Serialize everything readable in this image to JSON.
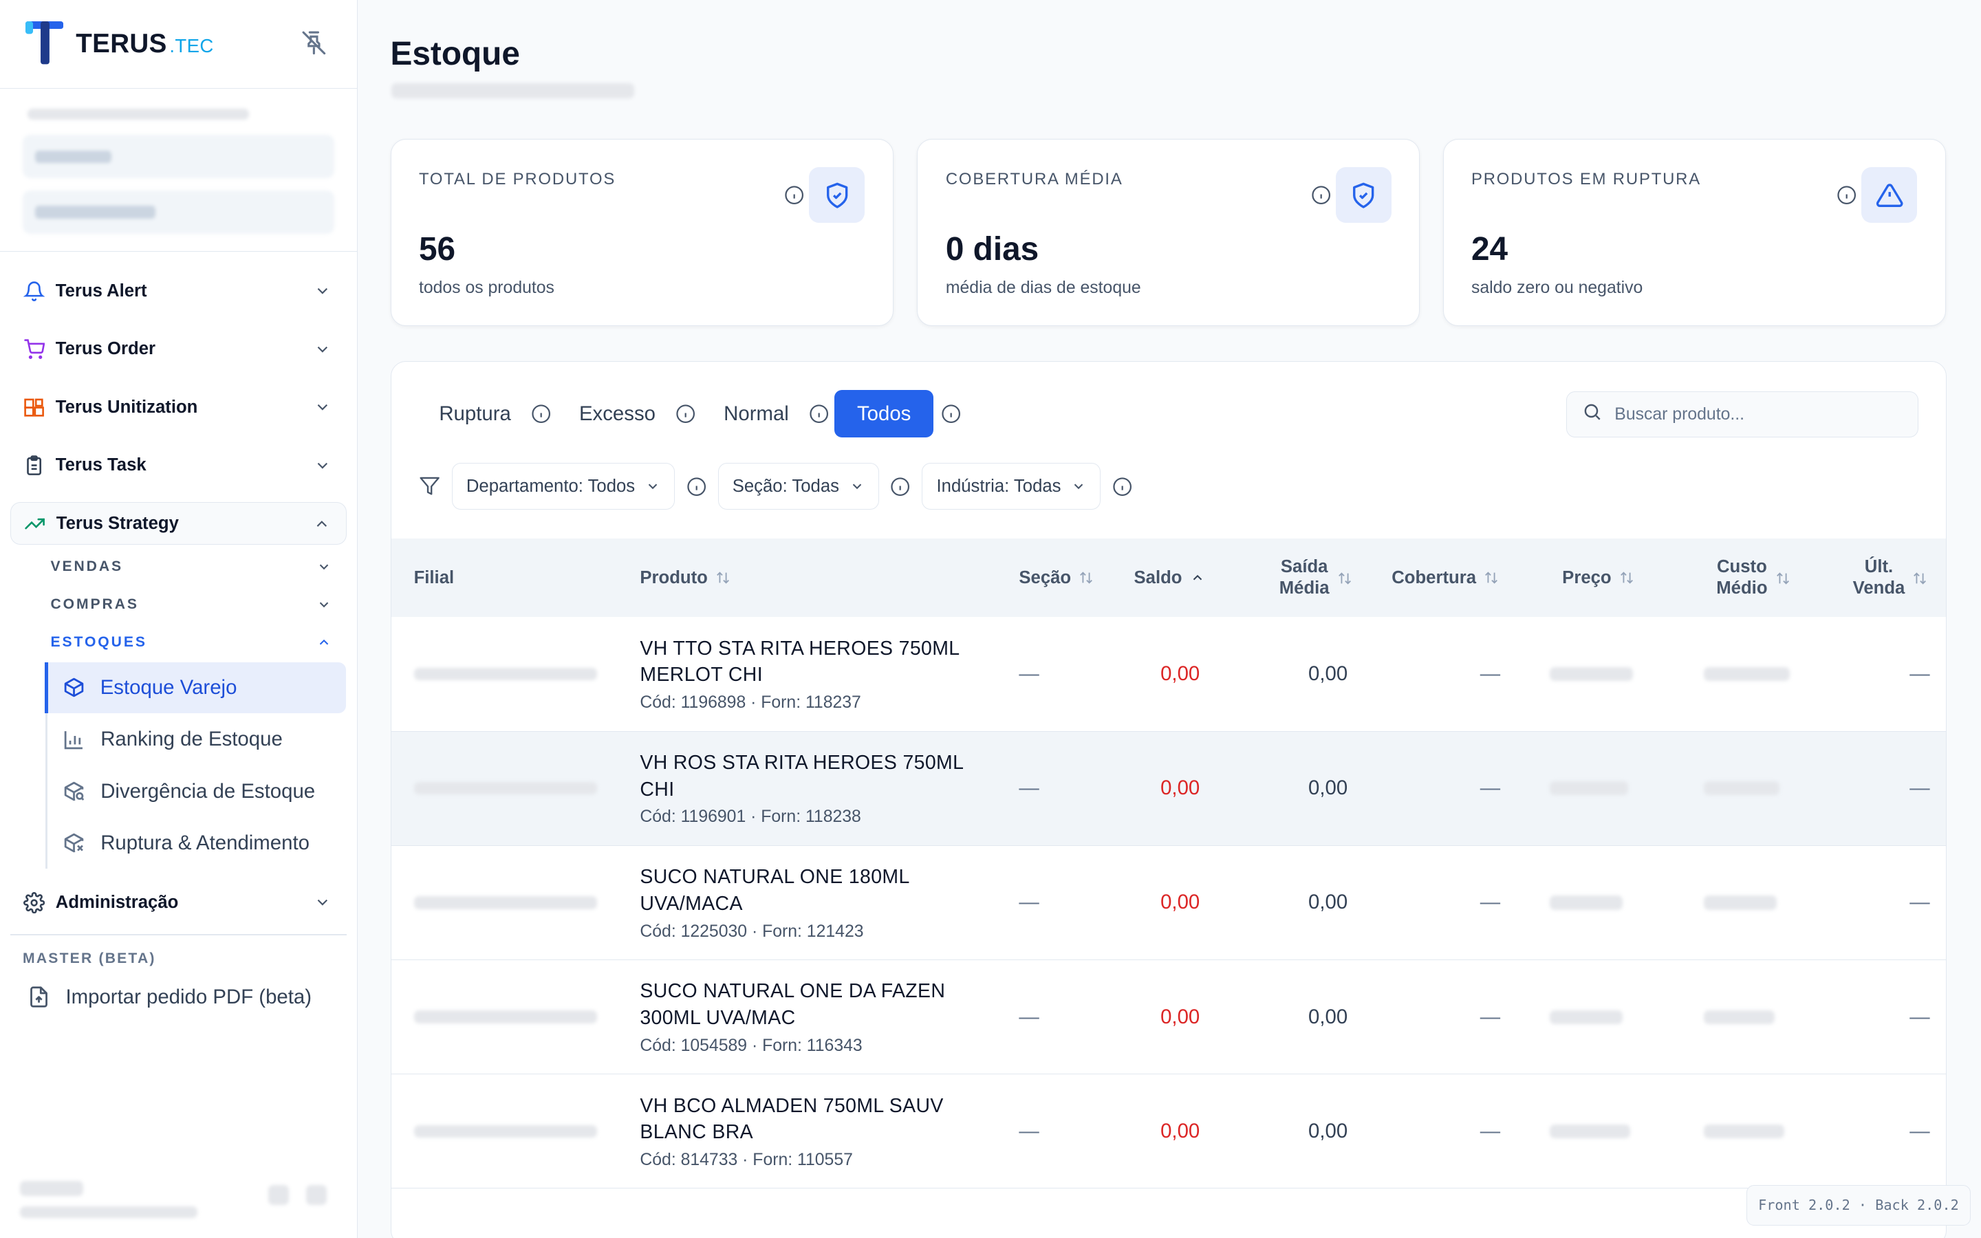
{
  "brand": {
    "name": "TERUS",
    "suffix": ".TEC",
    "primary": "#2563eb",
    "suffix_color": "#0ea5e9"
  },
  "sidebar": {
    "nav": [
      {
        "label": "Terus Alert",
        "icon": "bell-icon"
      },
      {
        "label": "Terus Order",
        "icon": "cart-icon"
      },
      {
        "label": "Terus Unitization",
        "icon": "boxes-icon"
      },
      {
        "label": "Terus Task",
        "icon": "clipboard-icon"
      },
      {
        "label": "Terus Strategy",
        "icon": "trending-up-icon"
      }
    ],
    "strategy_sections": [
      {
        "label": "VENDAS"
      },
      {
        "label": "COMPRAS"
      },
      {
        "label": "ESTOQUES"
      }
    ],
    "stock_items": [
      {
        "label": "Estoque Varejo",
        "icon": "package-icon"
      },
      {
        "label": "Ranking de Estoque",
        "icon": "bar-chart-icon"
      },
      {
        "label": "Divergência de Estoque",
        "icon": "package-search-icon"
      },
      {
        "label": "Ruptura & Atendimento",
        "icon": "package-x-icon"
      }
    ],
    "admin": {
      "label": "Administração",
      "icon": "gear-icon"
    },
    "master_label": "MASTER (BETA)",
    "master_item": {
      "label": "Importar pedido PDF (beta)",
      "icon": "file-import-icon"
    }
  },
  "page": {
    "title": "Estoque"
  },
  "cards": [
    {
      "label": "TOTAL DE PRODUTOS",
      "value": "56",
      "sub": "todos os produtos",
      "icon": "shield-check-icon"
    },
    {
      "label": "COBERTURA MÉDIA",
      "value": "0 dias",
      "sub": "média de dias de estoque",
      "icon": "shield-check-icon"
    },
    {
      "label": "PRODUTOS EM RUPTURA",
      "value": "24",
      "sub": "saldo zero ou negativo",
      "icon": "alert-triangle-icon"
    }
  ],
  "tabs": [
    {
      "label": "Ruptura",
      "active": false
    },
    {
      "label": "Excesso",
      "active": false
    },
    {
      "label": "Normal",
      "active": false
    },
    {
      "label": "Todos",
      "active": true
    }
  ],
  "search": {
    "placeholder": "Buscar produto..."
  },
  "filters": [
    {
      "label": "Departamento: Todos"
    },
    {
      "label": "Seção: Todas"
    },
    {
      "label": "Indústria: Todas"
    }
  ],
  "table": {
    "headers": {
      "filial": "Filial",
      "produto": "Produto",
      "secao": "Seção",
      "saldo": "Saldo",
      "saida_1": "Saída",
      "saida_2": "Média",
      "cobertura": "Cobertura",
      "preco": "Preço",
      "custo_1": "Custo",
      "custo_2": "Médio",
      "ult_1": "Últ.",
      "ult_2": "Venda"
    },
    "rows": [
      {
        "name_1": "VH TTO STA RITA HEROES 750ML",
        "name_2": "MERLOT CHI",
        "meta": "Cód: 1196898 · Forn: 118237",
        "secao": "—",
        "saldo": "0,00",
        "saida": "0,00",
        "cobertura": "—",
        "ult": "—"
      },
      {
        "name_1": "VH ROS STA RITA HEROES 750ML",
        "name_2": "CHI",
        "meta": "Cód: 1196901 · Forn: 118238",
        "secao": "—",
        "saldo": "0,00",
        "saida": "0,00",
        "cobertura": "—",
        "ult": "—"
      },
      {
        "name_1": "SUCO NATURAL ONE 180ML",
        "name_2": "UVA/MACA",
        "meta": "Cód: 1225030 · Forn: 121423",
        "secao": "—",
        "saldo": "0,00",
        "saida": "0,00",
        "cobertura": "—",
        "ult": "—"
      },
      {
        "name_1": "SUCO NATURAL ONE DA FAZEN",
        "name_2": "300ML UVA/MAC",
        "meta": "Cód: 1054589 · Forn: 116343",
        "secao": "—",
        "saldo": "0,00",
        "saida": "0,00",
        "cobertura": "—",
        "ult": "—"
      },
      {
        "name_1": "VH BCO ALMADEN 750ML SAUV",
        "name_2": "BLANC BRA",
        "meta": "Cód: 814733 · Forn: 110557",
        "secao": "—",
        "saldo": "0,00",
        "saida": "0,00",
        "cobertura": "—",
        "ult": "—"
      }
    ]
  },
  "version": "Front 2.0.2 · Back 2.0.2"
}
